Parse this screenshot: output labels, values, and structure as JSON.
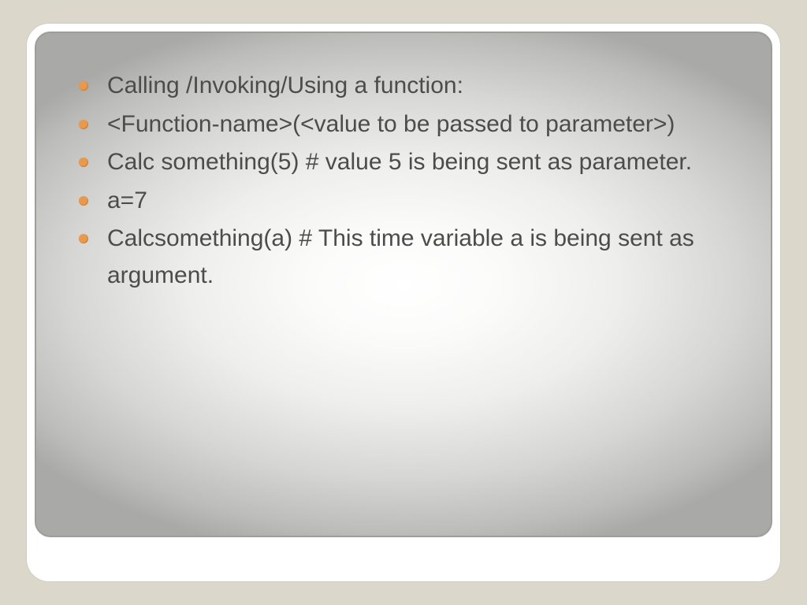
{
  "bullets": [
    "Calling /Invoking/Using a function:",
    "<Function-name>(<value to be passed to parameter>)",
    "Calc something(5)    # value 5 is being sent as parameter.",
    "a=7",
    "Calcsomething(a)    # This time variable a is being sent as argument."
  ]
}
